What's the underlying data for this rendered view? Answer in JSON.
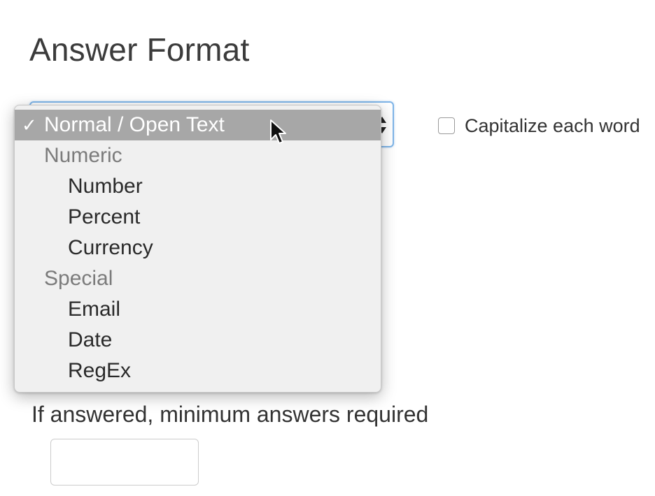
{
  "section": {
    "title": "Answer Format"
  },
  "format_select": {
    "selected_value": "Normal / Open Text",
    "options": [
      {
        "label": "Normal / Open Text",
        "kind": "option",
        "selected": true
      },
      {
        "label": "Numeric",
        "kind": "group"
      },
      {
        "label": "Number",
        "kind": "option"
      },
      {
        "label": "Percent",
        "kind": "option"
      },
      {
        "label": "Currency",
        "kind": "option"
      },
      {
        "label": "Special",
        "kind": "group"
      },
      {
        "label": "Email",
        "kind": "option"
      },
      {
        "label": "Date",
        "kind": "option"
      },
      {
        "label": "RegEx",
        "kind": "option"
      }
    ],
    "check_mark": "✓"
  },
  "capitalize": {
    "label": "Capitalize each word",
    "checked": false
  },
  "minimum": {
    "label": "If answered, minimum answers required",
    "value": "",
    "placeholder": ""
  },
  "colors": {
    "focus_border": "#7fb5e8",
    "menu_bg": "#f0f0f0",
    "selected_bg": "#a7a7a7",
    "group_text": "#7b7b7b"
  },
  "icons": {
    "select_arrows": "up-down-arrows-icon",
    "checkmark": "checkmark-icon",
    "pointer": "mouse-pointer-icon"
  }
}
